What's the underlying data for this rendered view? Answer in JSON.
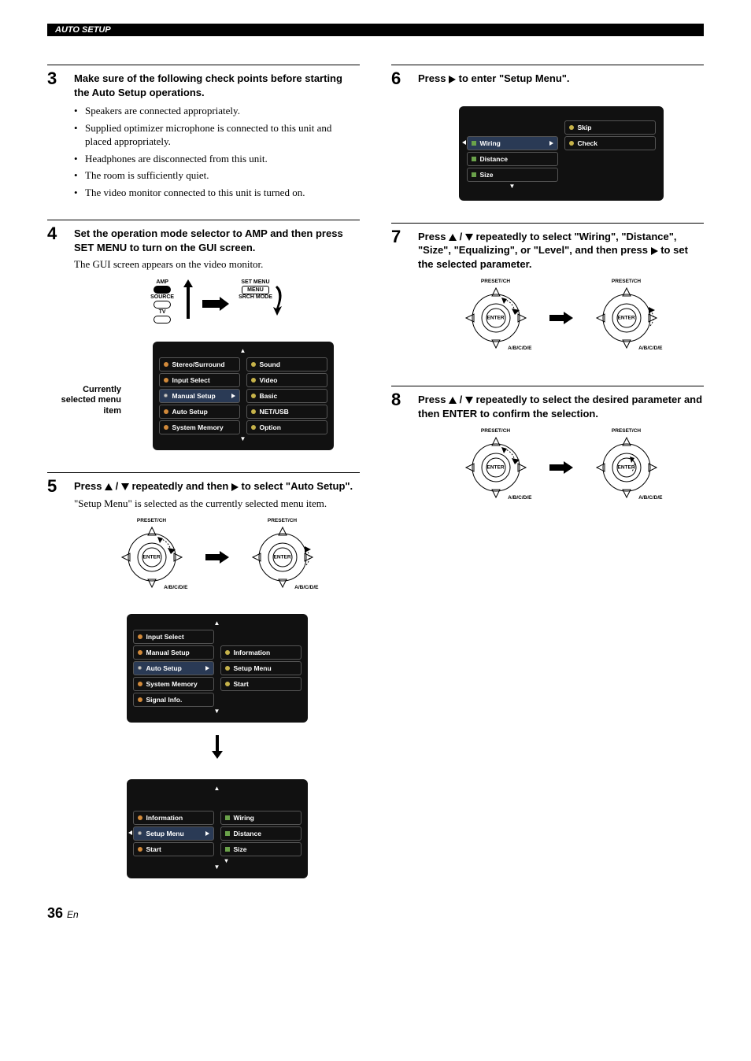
{
  "header": "AUTO SETUP",
  "page_number": "36",
  "page_lang": "En",
  "left": {
    "step3": {
      "num": "3",
      "title": "Make sure of the following check points before starting the Auto Setup operations.",
      "bullets": [
        "Speakers are connected appropriately.",
        "Supplied optimizer microphone is connected to this unit and placed appropriately.",
        "Headphones are disconnected from this unit.",
        "The room is sufficiently quiet.",
        "The video monitor connected to this unit is turned on."
      ]
    },
    "step4": {
      "num": "4",
      "title": "Set the operation mode selector to AMP and then press SET MENU to turn on the GUI screen.",
      "desc": "The GUI screen appears on the video monitor.",
      "selector": {
        "amp": "AMP",
        "source": "SOURCE",
        "tv": "TV"
      },
      "setmenu": {
        "label1": "SET MENU",
        "button": "MENU",
        "label2": "SRCH MODE"
      },
      "gui_label": "Currently selected menu item",
      "gui1_left": [
        "Stereo/Surround",
        "Input Select",
        "Manual Setup",
        "Auto Setup",
        "System Memory"
      ],
      "gui1_right": [
        "Sound",
        "Video",
        "Basic",
        "NET/USB",
        "Option"
      ]
    },
    "step5": {
      "num": "5",
      "title_parts": [
        "Press ",
        " / ",
        " repeatedly and then ",
        " to select \"Auto Setup\"."
      ],
      "desc": "\"Setup Menu\" is selected as the currently selected menu item.",
      "pad_top": "PRESET/CH",
      "pad_bot": "A/B/C/D/E",
      "enter": "ENTER",
      "gui2_left": [
        "Input Select",
        "Manual Setup",
        "Auto Setup",
        "System Memory",
        "Signal Info."
      ],
      "gui2_right": [
        "Information",
        "Setup Menu",
        "Start"
      ],
      "gui3_left": [
        "Information",
        "Setup Menu",
        "Start"
      ],
      "gui3_right": [
        "Wiring",
        "Distance",
        "Size"
      ]
    }
  },
  "right": {
    "step6": {
      "num": "6",
      "title_parts": [
        "Press ",
        " to enter \"Setup Menu\"."
      ],
      "gui_left": [
        "Wiring",
        "Distance",
        "Size"
      ],
      "gui_right": [
        "Skip",
        "Check"
      ]
    },
    "step7": {
      "num": "7",
      "title_parts": [
        "Press ",
        " / ",
        " repeatedly to select \"Wiring\", \"Distance\", \"Size\", \"Equalizing\", or \"Level\", and then press ",
        " to set the selected parameter."
      ],
      "pad_top": "PRESET/CH",
      "pad_bot": "A/B/C/D/E",
      "enter": "ENTER"
    },
    "step8": {
      "num": "8",
      "title_parts": [
        "Press ",
        " / ",
        " repeatedly to select the desired parameter and then ENTER to confirm the selection."
      ],
      "pad_top": "PRESET/CH",
      "pad_bot": "A/B/C/D/E",
      "enter": "ENTER"
    }
  }
}
